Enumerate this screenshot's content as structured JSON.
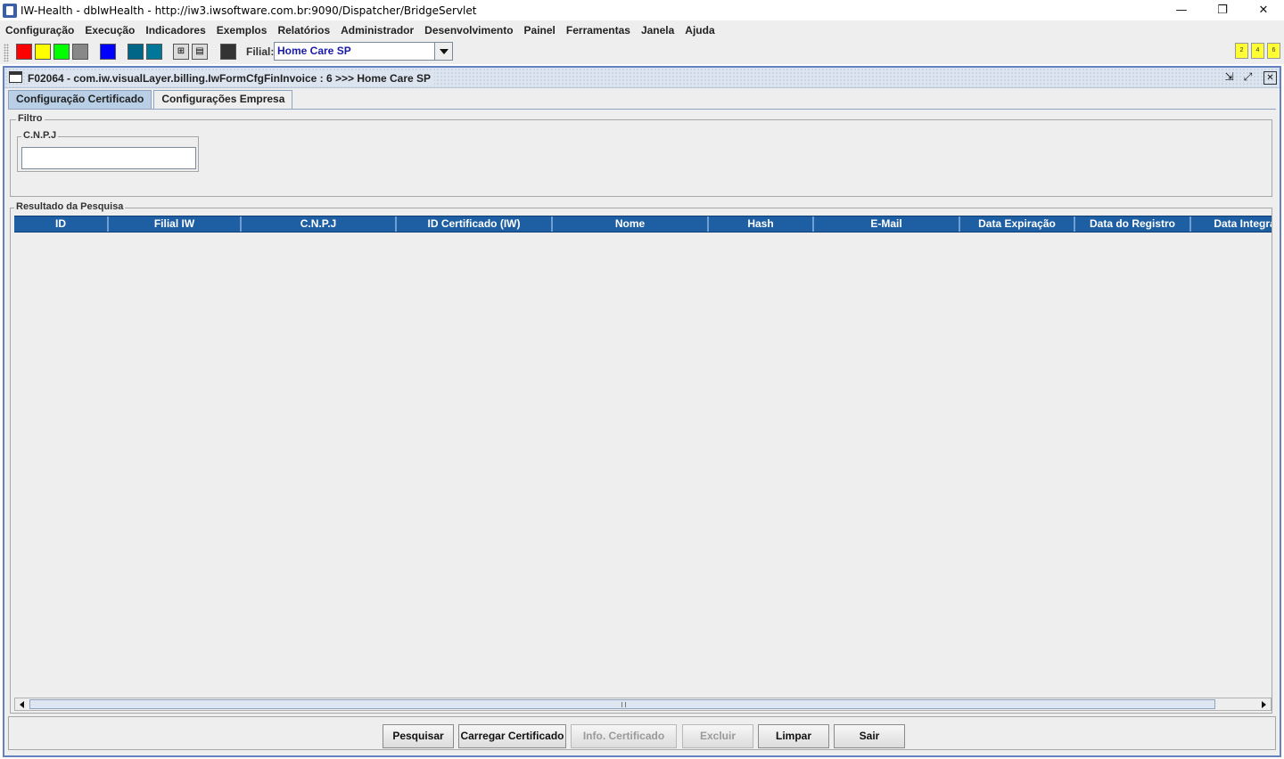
{
  "window": {
    "title": "IW-Health - dbIwHealth - http://iw3.iwsoftware.com.br:9090/Dispatcher/BridgeServlet",
    "minimize": "—",
    "maximize": "❐",
    "close": "✕"
  },
  "menu": [
    "Configuração",
    "Execução",
    "Indicadores",
    "Exemplos",
    "Relatórios",
    "Administrador",
    "Desenvolvimento",
    "Painel",
    "Ferramentas",
    "Janela",
    "Ajuda"
  ],
  "toolbar": {
    "colors": [
      "#ff0000",
      "#ffff00",
      "#00ff00",
      "#888888",
      "#0000ff",
      "#006688",
      "#007799",
      "#333333"
    ],
    "filial_label": "Filial:",
    "filial_value": "Home Care SP",
    "badges": [
      "2",
      "4",
      "6"
    ]
  },
  "frame": {
    "title": "F02064 - com.iw.visualLayer.billing.IwFormCfgFinInvoice : 6 >>> Home Care SP",
    "tabs": [
      "Configuração Certificado",
      "Configurações Empresa"
    ],
    "active_tab": 0
  },
  "filter": {
    "group_title": "Filtro",
    "cnpj_label": "C.N.P.J",
    "cnpj_value": ""
  },
  "results": {
    "group_title": "Resultado da Pesquisa",
    "columns": [
      "ID",
      "Filial IW",
      "C.N.P.J",
      "ID Certificado (IW)",
      "Nome",
      "Hash",
      "E-Mail",
      "Data Expiração",
      "Data do Registro",
      "Data Integra"
    ],
    "rows": []
  },
  "buttons": {
    "pesquisar": "Pesquisar",
    "carregar": "Carregar Certificado",
    "info": "Info. Certificado",
    "excluir": "Excluir",
    "limpar": "Limpar",
    "sair": "Sair"
  }
}
